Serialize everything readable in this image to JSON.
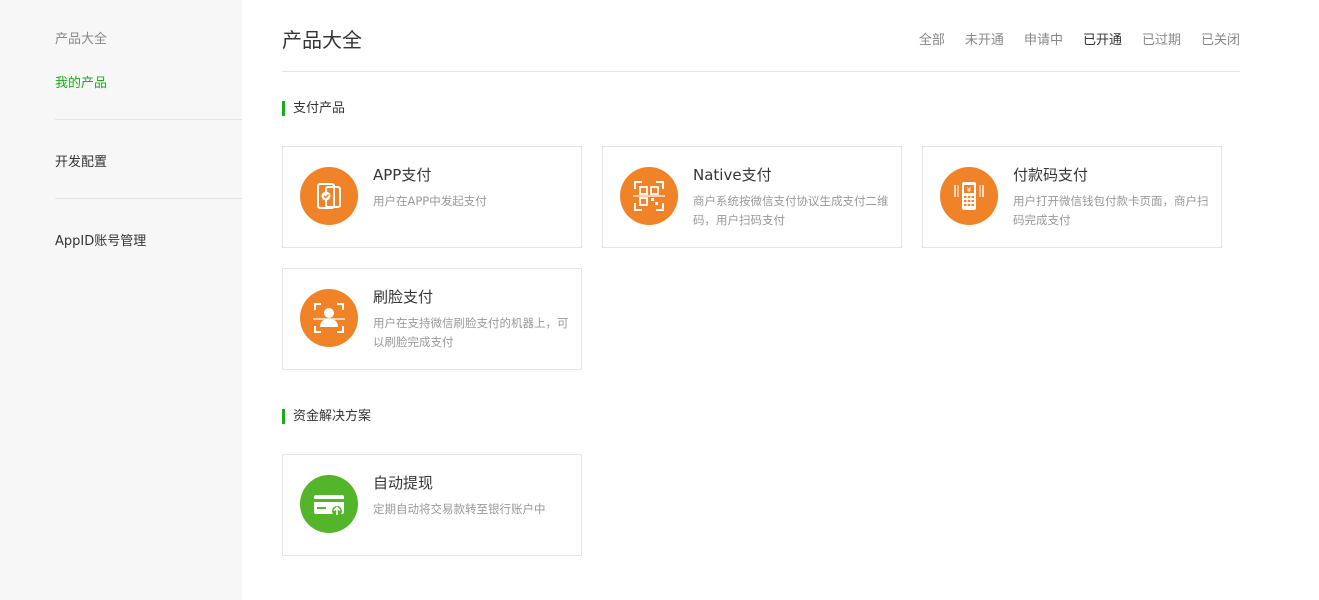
{
  "sidebar": {
    "group_title": "产品大全",
    "items": [
      {
        "label": "我的产品",
        "active": true
      },
      {
        "label": "开发配置",
        "active": false
      },
      {
        "label": "AppID账号管理",
        "active": false
      }
    ]
  },
  "main": {
    "title": "产品大全",
    "filters": [
      "全部",
      "未开通",
      "申请中",
      "已开通",
      "已过期",
      "已关闭"
    ],
    "active_filter": "已开通",
    "sections": [
      {
        "heading": "支付产品",
        "cards": [
          {
            "name": "APP支付",
            "desc": "用户在APP中发起支付",
            "icon": "app-phone-icon",
            "color": "#f08327"
          },
          {
            "name": "Native支付",
            "desc": "商户系统按微信支付协议生成支付二维码，用户扫码支付",
            "icon": "qr-scan-icon",
            "color": "#f08327"
          },
          {
            "name": "付款码支付",
            "desc": "用户打开微信钱包付款卡页面，商户扫码完成支付",
            "icon": "pos-terminal-icon",
            "color": "#f08327"
          },
          {
            "name": "刷脸支付",
            "desc": "用户在支持微信刷脸支付的机器上，可以刷脸完成支付",
            "icon": "face-scan-icon",
            "color": "#f08327"
          }
        ]
      },
      {
        "heading": "资金解决方案",
        "cards": [
          {
            "name": "自动提现",
            "desc": "定期自动将交易款转至银行账户中",
            "icon": "card-withdraw-icon",
            "color": "#52b52a"
          }
        ]
      }
    ]
  },
  "colors": {
    "accent": "#1aad19",
    "orange_icon": "#f08327",
    "green_icon": "#52b52a"
  }
}
